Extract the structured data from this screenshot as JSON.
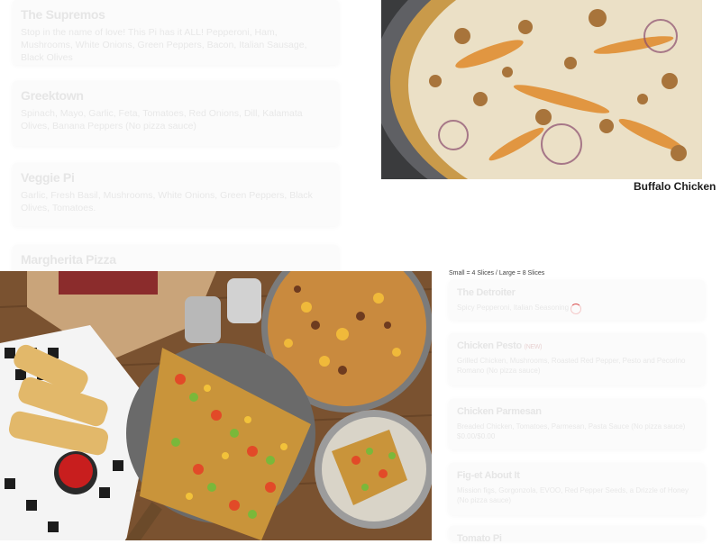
{
  "left_menu": [
    {
      "name": "The Supremos",
      "desc": "Stop in the name of love! This Pi has it ALL! Pepperoni, Ham, Mushrooms, White Onions, Green Peppers, Bacon, Italian Sausage, Black Olives"
    },
    {
      "name": "Greektown",
      "desc": "Spinach, Mayo, Garlic, Feta, Tomatoes, Red Onions, Dill, Kalamata Olives, Banana Peppers (No pizza sauce)"
    },
    {
      "name": "Veggie Pi",
      "desc": "Garlic, Fresh Basil, Mushrooms, White Onions, Green Peppers, Black Olives, Tomatoes."
    },
    {
      "name": "Margherita Pizza",
      "desc": ""
    }
  ],
  "photo_caption": "Buffalo Chicken",
  "slice_note": "Small = 4 Slices / Large = 8 Slices",
  "right_menu": [
    {
      "name": "The Detroiter",
      "badge": "",
      "desc": "Spicy Pepperoni, Italian Seasoning"
    },
    {
      "name": "Chicken Pesto",
      "badge": "(NEW)",
      "desc": "Grilled Chicken, Mushrooms, Roasted Red Pepper, Pesto and Pecorino Romano (No pizza sauce)"
    },
    {
      "name": "Chicken Parmesan",
      "badge": "",
      "desc": "Breaded Chicken, Tomatoes, Parmesan, Pasta Sauce (No pizza sauce) $0.00/$0.00"
    },
    {
      "name": "Fig-et About It",
      "badge": "",
      "desc": "Mission figs, Gorgonzola, EVOO, Red Pepper Seeds, a Drizzle of Honey (No pizza sauce)"
    },
    {
      "name": "Tomato Pi",
      "badge": "",
      "desc": ""
    }
  ]
}
